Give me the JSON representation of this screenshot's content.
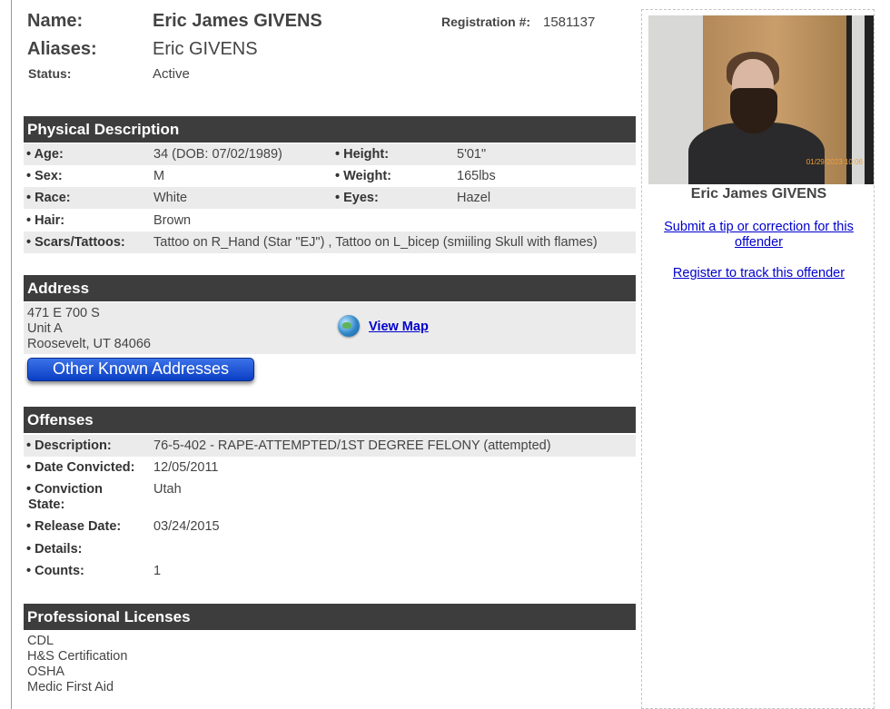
{
  "header": {
    "name_label": "Name:",
    "name": "Eric James GIVENS",
    "aliases_label": "Aliases:",
    "aliases": "Eric GIVENS",
    "status_label": "Status:",
    "status": "Active",
    "registration_label": "Registration #:",
    "registration": "1581137"
  },
  "physical": {
    "title": "Physical Description",
    "rows": [
      {
        "label": "• Age:",
        "value": "34  (DOB: 07/02/1989)",
        "label2": "• Height:",
        "value2": "5'01\""
      },
      {
        "label": "• Sex:",
        "value": "M",
        "label2": "• Weight:",
        "value2": "165lbs"
      },
      {
        "label": "• Race:",
        "value": "White",
        "label2": "• Eyes:",
        "value2": "Hazel"
      },
      {
        "label": "• Hair:",
        "value": "Brown"
      },
      {
        "label": "• Scars/Tattoos:",
        "value": "Tattoo on R_Hand (Star \"EJ\") , Tattoo on L_bicep (smiiling Skull with flames)"
      }
    ]
  },
  "address": {
    "title": "Address",
    "lines": [
      "471 E 700 S",
      "Unit A",
      "Roosevelt, UT 84066"
    ],
    "map_link": "View Map",
    "other_button": "Other Known Addresses"
  },
  "offenses": {
    "title": "Offenses",
    "description_label": "• Description:",
    "description": "76-5-402 - RAPE-ATTEMPTED/1ST DEGREE FELONY (attempted)",
    "date_convicted_label": "• Date Convicted:",
    "date_convicted": "12/05/2011",
    "conviction_state_label_1": "• Conviction",
    "conviction_state_label_2": "State:",
    "conviction_state": "Utah",
    "release_date_label": "• Release Date:",
    "release_date": "03/24/2015",
    "details_label": "• Details:",
    "details": "",
    "counts_label": "• Counts:",
    "counts": "1"
  },
  "licenses": {
    "title": "Professional Licenses",
    "items": [
      "CDL",
      "H&S Certification",
      "OSHA",
      "Medic First Aid"
    ]
  },
  "sidebar": {
    "photo_stamp": "01/29/2023 10:06",
    "name": "Eric James GIVENS",
    "tip_link_1": "Submit a tip or correction for this",
    "tip_link_2": "offender",
    "register_link": "Register to track this offender"
  },
  "colors": {
    "section_bar": "#3d3d3d",
    "row_shade": "#ebebeb",
    "link": "#0000cc",
    "button": "#0a3fc4"
  }
}
